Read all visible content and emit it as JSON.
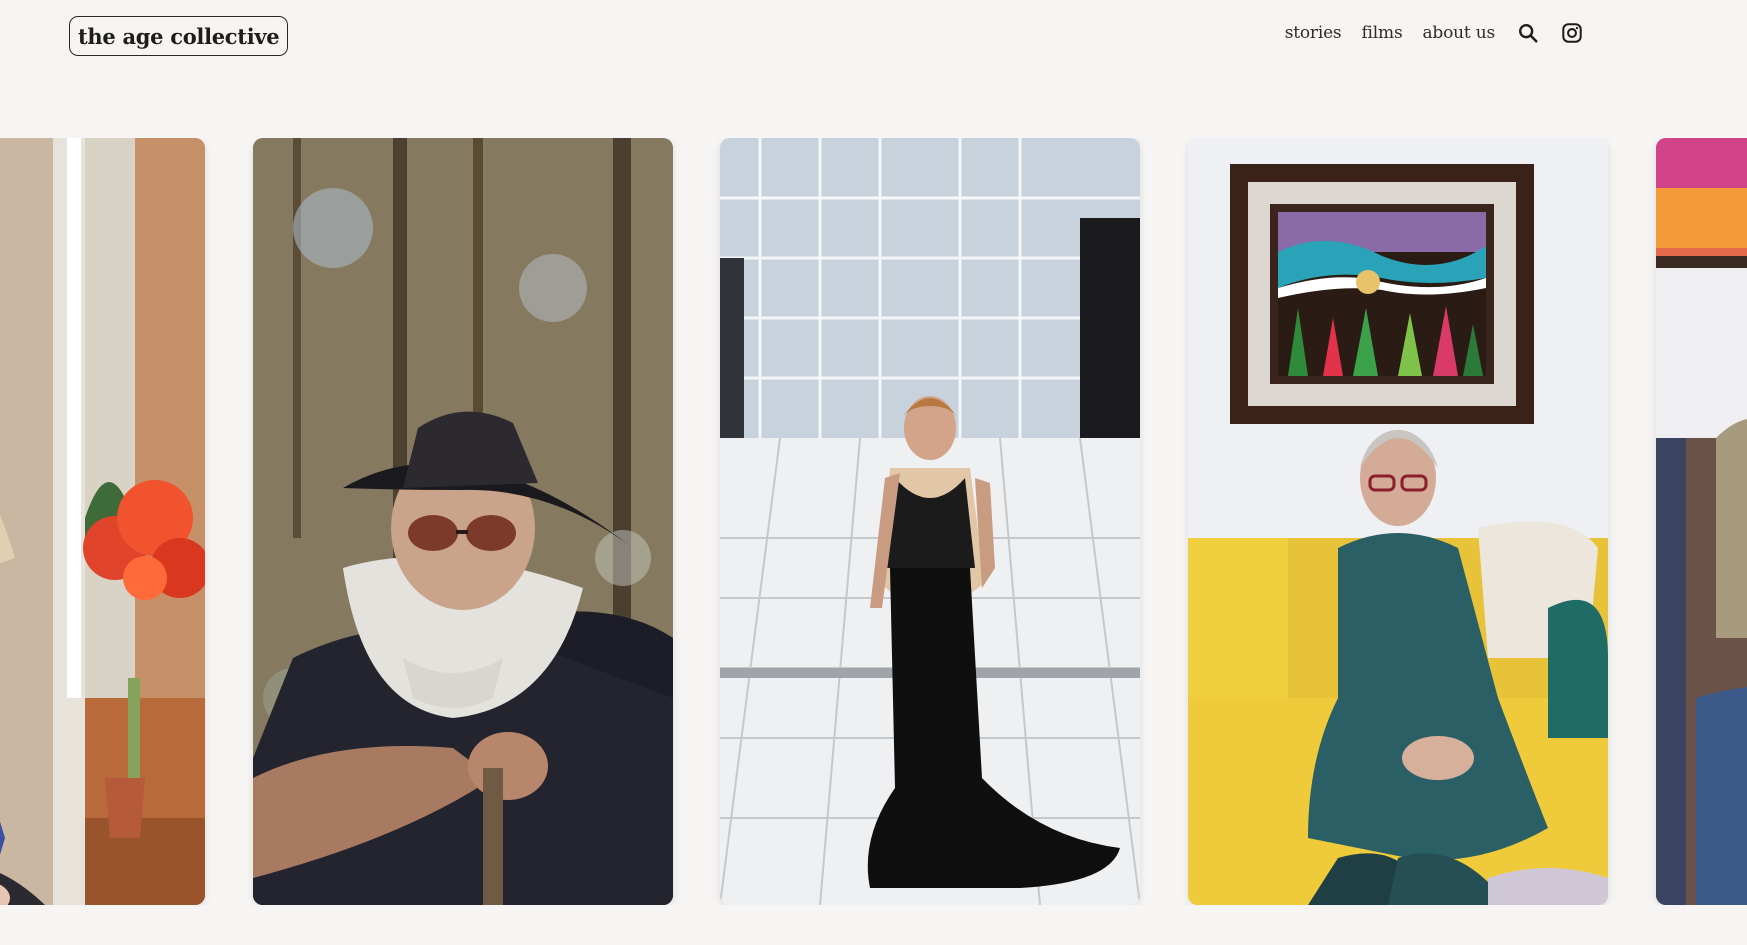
{
  "site": {
    "logo": "the age collective"
  },
  "nav": {
    "items": [
      {
        "label": "stories"
      },
      {
        "label": "films"
      },
      {
        "label": "about us"
      }
    ],
    "search_icon": "search-icon",
    "instagram_icon": "instagram-icon"
  },
  "carousel": {
    "cards": [
      {
        "icon": "portrait-woman-with-flowers"
      },
      {
        "icon": "portrait-bearded-man-with-hat"
      },
      {
        "icon": "portrait-woman-in-black-gown"
      },
      {
        "icon": "portrait-woman-on-yellow-sofa"
      },
      {
        "icon": "portrait-person-on-sofa"
      }
    ]
  },
  "colors": {
    "background": "#f6f5f3",
    "text": "#2a2826"
  }
}
